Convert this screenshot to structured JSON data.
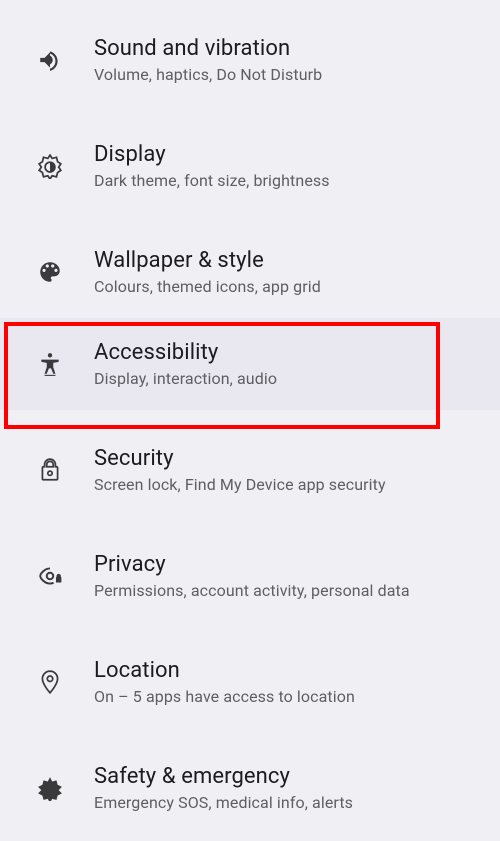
{
  "settings": [
    {
      "key": "sound",
      "icon": "volume-icon",
      "title": "Sound and vibration",
      "subtitle": "Volume, haptics, Do Not Disturb"
    },
    {
      "key": "display",
      "icon": "brightness-icon",
      "title": "Display",
      "subtitle": "Dark theme, font size, brightness"
    },
    {
      "key": "wallpaper",
      "icon": "palette-icon",
      "title": "Wallpaper & style",
      "subtitle": "Colours, themed icons, app grid"
    },
    {
      "key": "accessibility",
      "icon": "accessibility-icon",
      "title": "Accessibility",
      "subtitle": "Display, interaction, audio",
      "highlighted": true
    },
    {
      "key": "security",
      "icon": "lock-icon",
      "title": "Security",
      "subtitle": "Screen lock, Find My Device app security"
    },
    {
      "key": "privacy",
      "icon": "privacy-icon",
      "title": "Privacy",
      "subtitle": "Permissions, account activity, personal data"
    },
    {
      "key": "location",
      "icon": "location-icon",
      "title": "Location",
      "subtitle": "On – 5 apps have access to location"
    },
    {
      "key": "safety",
      "icon": "medical-icon",
      "title": "Safety & emergency",
      "subtitle": "Emergency SOS, medical info, alerts"
    }
  ]
}
